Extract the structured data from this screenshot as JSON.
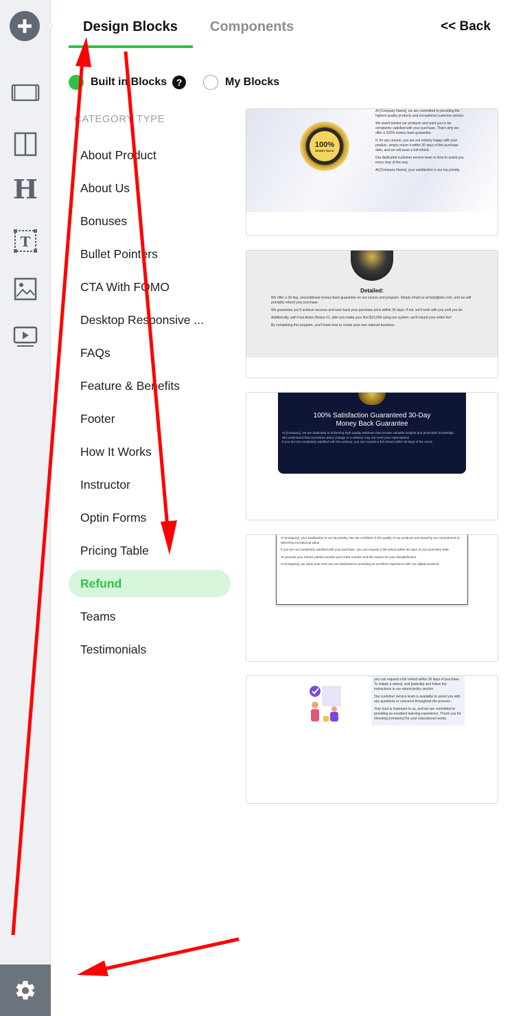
{
  "tabs": {
    "design": "Design Blocks",
    "components": "Components",
    "back": "<< Back"
  },
  "source_options": {
    "built_in": "Built in Blocks",
    "my_blocks": "My Blocks",
    "selected": "Built in Blocks"
  },
  "category": {
    "header": "CATEGORY TYPE",
    "items": [
      "About Product",
      "About Us",
      "Bonuses",
      "Bullet Pointers",
      "CTA With FOMO",
      "Desktop Responsive ...",
      "FAQs",
      "Feature & Benefits",
      "Footer",
      "How It Works",
      "Instructor",
      "Optin Forms",
      "Pricing Table",
      "Refund",
      "Teams",
      "Testimonials"
    ],
    "active": "Refund"
  },
  "thumbnails": {
    "t1": {
      "badge": "100%",
      "badge_sub": "MONEY BACK",
      "lines": [
        "At [Company Name], we are committed to providing the highest quality products and exceptional customer service.",
        "We stand behind our products and want you to be completely satisfied with your purchase. That's why we offer a 100% money-back guarantee.",
        "If, for any reason, you are not entirely happy with your product, simply return it within 30 days of the purchase date, and we will issue a full refund.",
        "Our dedicated customer service team is here to assist you every step of the way.",
        "At [Company Name], your satisfaction is our top priority."
      ]
    },
    "t2": {
      "heading": "Detailed:",
      "lines": [
        "We offer a 30-day, unconditional money-back guarantee on our course and program. Simply email us at help@abc.com, and we will promptly refund your purchase.",
        "We guarantee you'll achieve success and earn back your purchase price within 30 days. If not, we'll work with you until you do.",
        "Additionally, with Fast Action Bonus #1, after you make your first $10,000 using our system, we'll refund your entire fee!",
        "By completing this program, you'll learn how to create your own internet business."
      ]
    },
    "t3": {
      "title": "100% Satisfaction Guaranteed 30-Day",
      "title2": "Money Back Guarantee",
      "lines": [
        "At [company], we are dedicated to delivering high-quality webinars that provide valuable insights and actionable knowledge.",
        "We understand that sometimes plans change or a webinar may not meet your expectations.",
        "If you are not completely satisfied with the webinar, you can request a full refund within 30 days of the event."
      ]
    },
    "t4": {
      "lines": [
        "At [company], your satisfaction is our top priority. We are confident in the quality of our products and stand by our commitment to delivering exceptional value.",
        "If you are not completely satisfied with your purchase, you can request a full refund within 60 days of your purchase date.",
        "To process your refund, please provide your order number and the reason for your dissatisfaction.",
        "At [company], we value your trust and are dedicated to providing an excellent experience with our digital products."
      ]
    },
    "t5": {
      "lines": [
        "you can request a full refund within 30 days of purchase. To initiate a refund, visit [website] and follow the instructions in our refund policy section.",
        "Our customer service team is available to assist you with any questions or concerns throughout the process.",
        "Your trust is important to us, and we are committed to providing an excellent learning experience. Thank you for choosing [company] for your educational needs."
      ]
    }
  },
  "rail": {
    "items": [
      "add-icon",
      "section-icon",
      "columns-icon",
      "heading-icon",
      "text-icon",
      "image-icon",
      "video-icon"
    ],
    "heading_glyph": "H",
    "text_glyph": "T",
    "settings": "gear-icon"
  },
  "colors": {
    "accent": "#2ec24a",
    "active_bg": "#d6f5d9",
    "rail_bg": "#eef0f3",
    "annotation": "#ff0000"
  }
}
